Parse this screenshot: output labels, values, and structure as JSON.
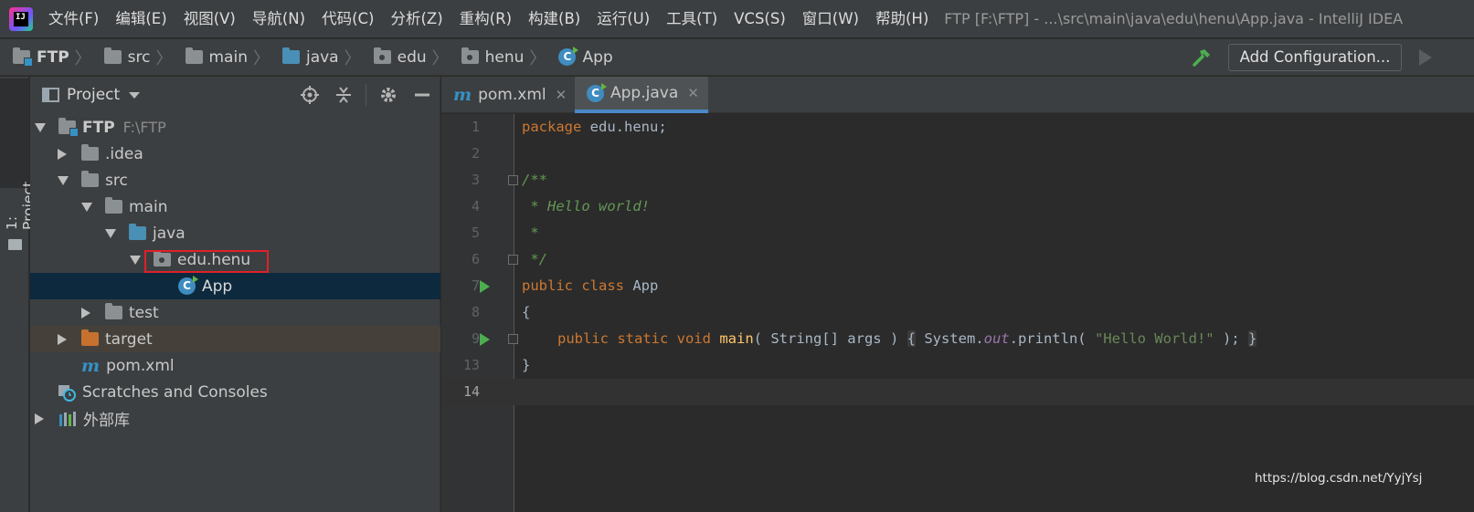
{
  "menu": {
    "items": [
      "文件(F)",
      "编辑(E)",
      "视图(V)",
      "导航(N)",
      "代码(C)",
      "分析(Z)",
      "重构(R)",
      "构建(B)",
      "运行(U)",
      "工具(T)",
      "VCS(S)",
      "窗口(W)",
      "帮助(H)"
    ],
    "window_title": "FTP [F:\\FTP] - ...\\src\\main\\java\\edu\\henu\\App.java - IntelliJ IDEA"
  },
  "breadcrumb": [
    "FTP",
    "src",
    "main",
    "java",
    "edu",
    "henu",
    "App"
  ],
  "toolbar": {
    "add_configuration": "Add Configuration..."
  },
  "side_tool": {
    "project_label": "1: Project"
  },
  "project_panel": {
    "title": "Project",
    "tree": [
      {
        "label": "FTP",
        "path": "F:\\FTP"
      },
      {
        "label": ".idea"
      },
      {
        "label": "src"
      },
      {
        "label": "main"
      },
      {
        "label": "java"
      },
      {
        "label": "edu.henu"
      },
      {
        "label": "App"
      },
      {
        "label": "test"
      },
      {
        "label": "target"
      },
      {
        "label": "pom.xml"
      },
      {
        "label": "Scratches and Consoles"
      },
      {
        "label": "外部库"
      }
    ]
  },
  "tabs": [
    {
      "label": "pom.xml",
      "icon": "maven-icon"
    },
    {
      "label": "App.java",
      "icon": "java-class-icon",
      "active": true
    }
  ],
  "editor": {
    "line_numbers": [
      "1",
      "2",
      "3",
      "4",
      "5",
      "6",
      "7",
      "8",
      "9",
      "13",
      "14"
    ],
    "lines": {
      "l1_kw": "package",
      "l1_rest": " edu.henu;",
      "l3": "/**",
      "l4": " * Hello world!",
      "l5": " *",
      "l6": " */",
      "l7_kw": "public class",
      "l7_rest": " App",
      "l8": "{",
      "l9_kw": "public static void",
      "l9_fn": "main",
      "l9_params": "( String[] args )",
      "l9_open": "{",
      "l9_sys": " System.",
      "l9_out": "out",
      "l9_call": ".println( ",
      "l9_str": "\"Hello World!\"",
      "l9_end": " ); ",
      "l9_close": "}",
      "l13": "}"
    }
  },
  "watermark": "https://blog.csdn.net/YyjYsj",
  "colors": {
    "highlight_box": "#e0202a",
    "selection": "#0d293e",
    "target_row": "#45413a",
    "accent_tab": "#4a88c7"
  }
}
